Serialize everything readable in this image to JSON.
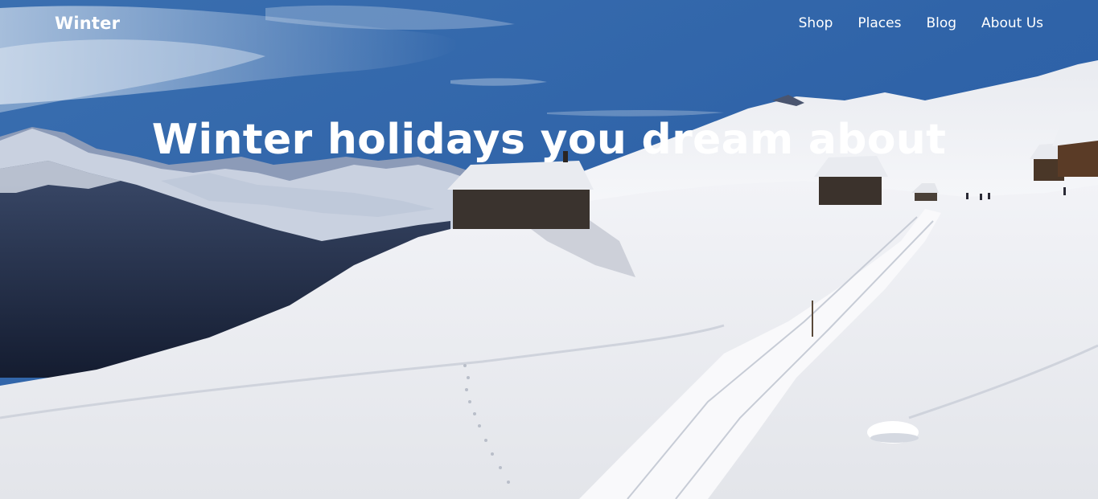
{
  "header": {
    "logo": "Winter",
    "nav": [
      "Shop",
      "Places",
      "Blog",
      "About Us"
    ]
  },
  "hero": {
    "headline": "Winter holidays you dream about",
    "image_description": "snowy alpine slope with wooden chalets under blue sky"
  },
  "colors": {
    "sky": "#2f63a6",
    "snow": "#eef0f4",
    "mountain": "#1f2a44",
    "text": "#ffffff"
  }
}
